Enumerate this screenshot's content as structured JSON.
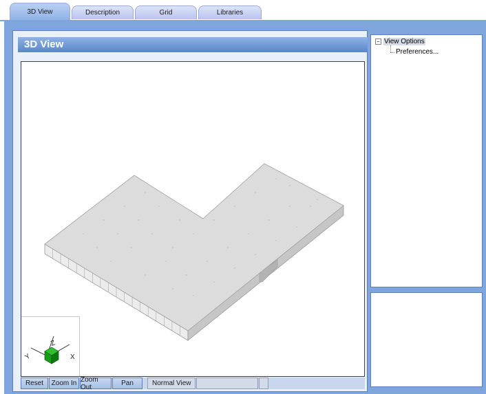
{
  "tabs": [
    {
      "label": "3D View",
      "active": true
    },
    {
      "label": "Description",
      "active": false
    },
    {
      "label": "Grid",
      "active": false
    },
    {
      "label": "Libraries",
      "active": false
    }
  ],
  "panel": {
    "title": "3D View"
  },
  "axes": {
    "x_label": "X",
    "y_label": "Y",
    "z_label": "Z",
    "cube_color": "#1a9b1a"
  },
  "toolbar": {
    "reset": "Reset",
    "zoom_in": "Zoom In",
    "zoom_out": "Zoom Out",
    "pan": "Pan",
    "view_mode": "Normal View"
  },
  "tree": {
    "root": "View Options",
    "root_expanded": true,
    "children": [
      "Preferences..."
    ]
  },
  "colors": {
    "accent": "#7fa6dc",
    "header": "#5a86c8",
    "slab_top": "#dcdcdc",
    "slab_side": "#c4c4c4"
  }
}
